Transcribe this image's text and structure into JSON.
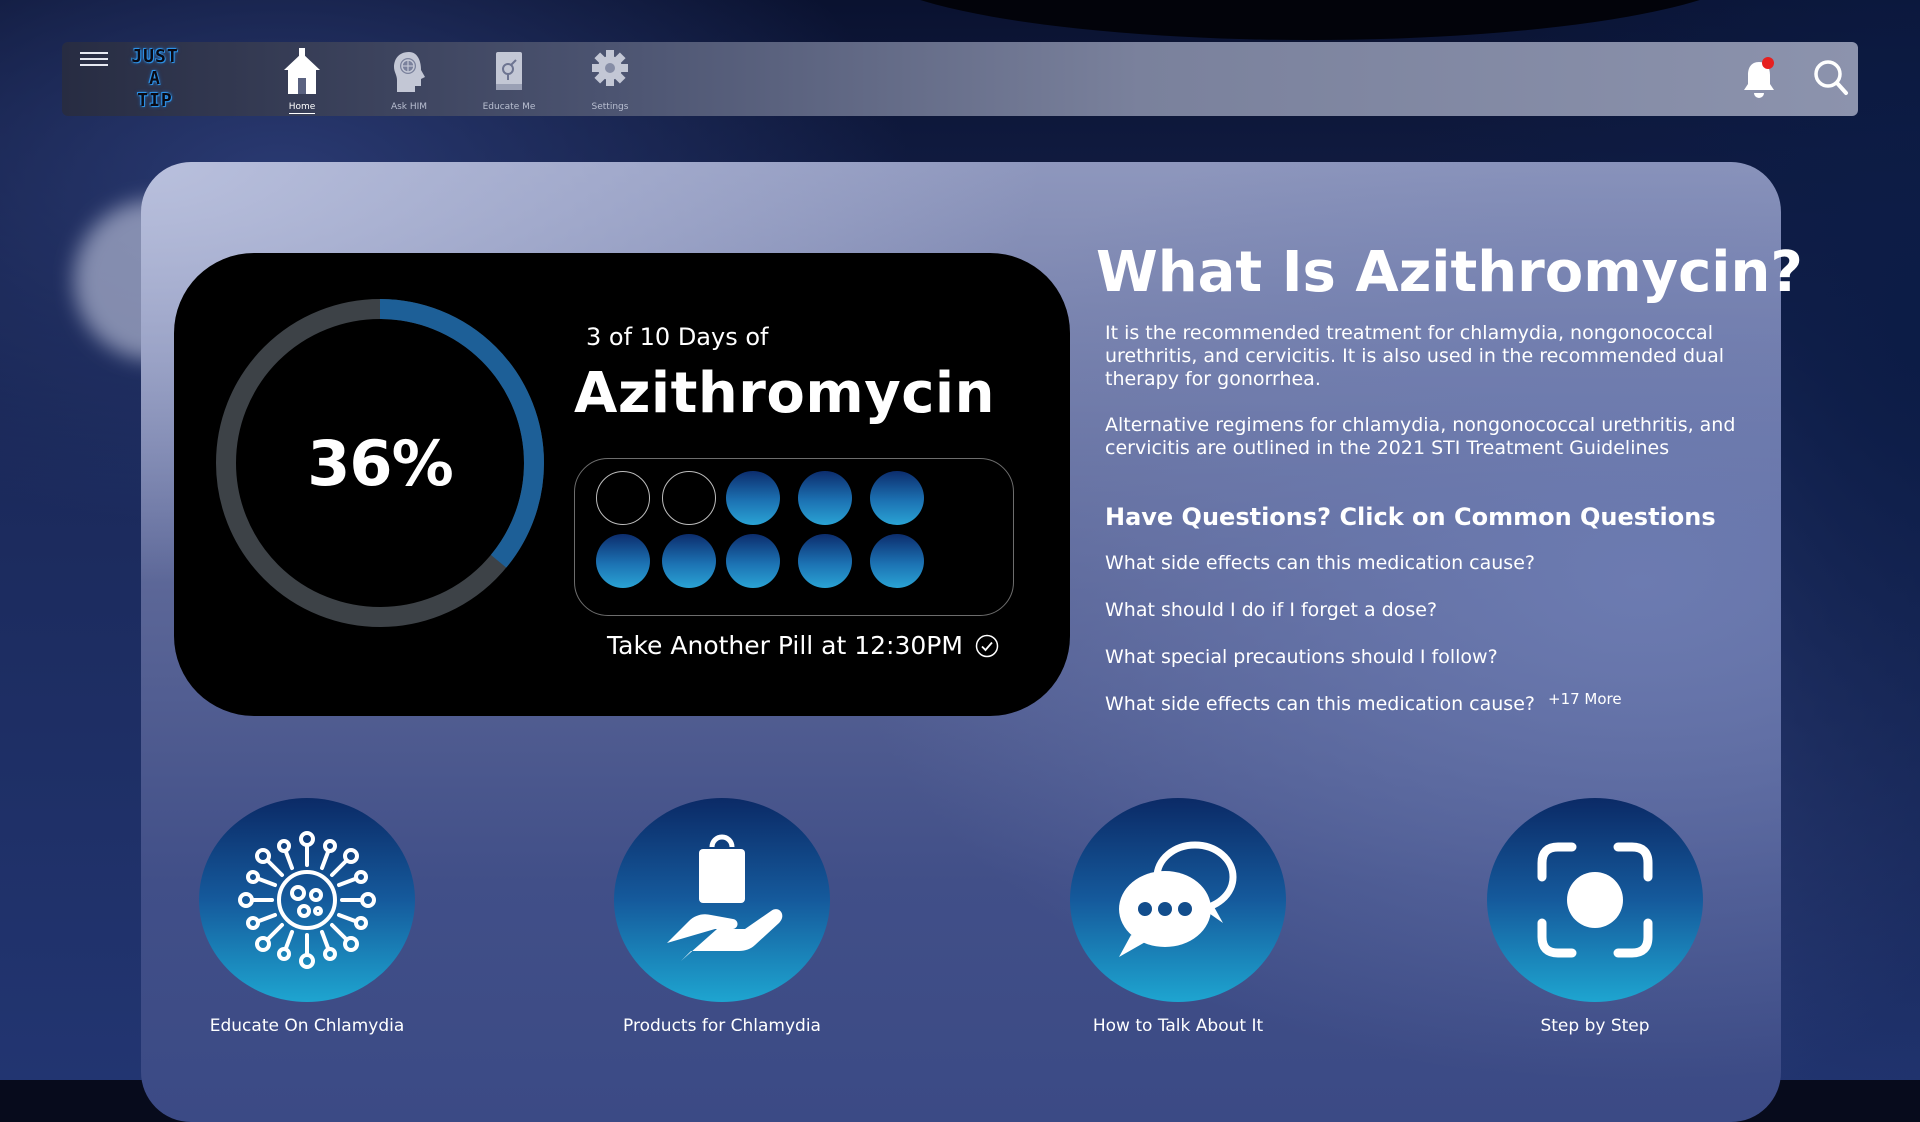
{
  "app": {
    "logo_lines": [
      "JUST",
      "A",
      "TIP"
    ]
  },
  "nav": {
    "items": [
      {
        "label": "Home",
        "icon": "home-icon",
        "active": true
      },
      {
        "label": "Ask HIM",
        "icon": "head-globe-icon",
        "active": false
      },
      {
        "label": "Educate Me",
        "icon": "book-gender-icon",
        "active": false
      },
      {
        "label": "Settings",
        "icon": "gear-icon",
        "active": false
      }
    ],
    "notification_dot_color": "#e62020"
  },
  "tracker": {
    "progress_percent": 36,
    "progress_label": "36%",
    "days_text": "3 of 10 Days of",
    "medication": "Azithromycin",
    "pills_taken": 2,
    "pills_total": 10,
    "next_pill_text": "Take Another Pill at 12:30PM",
    "ring_color": "#1d5f97",
    "ring_track_color": "#3d4247"
  },
  "info": {
    "title": "What Is Azithromycin?",
    "paragraph1": "It is the recommended treatment for chlamydia, nongonococcal urethritis, and cervicitis. It is also used in the recommended dual therapy for gonorrhea.",
    "paragraph2": "Alternative regimens for chlamydia, nongonococcal urethritis, and cervicitis are outlined in the 2021 STI Treatment Guidelines",
    "questions_header": "Have Questions? Click on Common Questions",
    "questions": [
      "What side effects can this medication cause?",
      "What should I do if I forget a dose?",
      "What special precautions should I follow?",
      "What side effects can this medication cause?"
    ],
    "more_label": "+17 More"
  },
  "actions": [
    {
      "label": "Educate On Chlamydia",
      "icon": "virus-icon"
    },
    {
      "label": "Products for Chlamydia",
      "icon": "hand-bag-icon"
    },
    {
      "label": "How to Talk About It",
      "icon": "chat-bubbles-icon"
    },
    {
      "label": "Step by Step",
      "icon": "camera-focus-icon"
    }
  ]
}
